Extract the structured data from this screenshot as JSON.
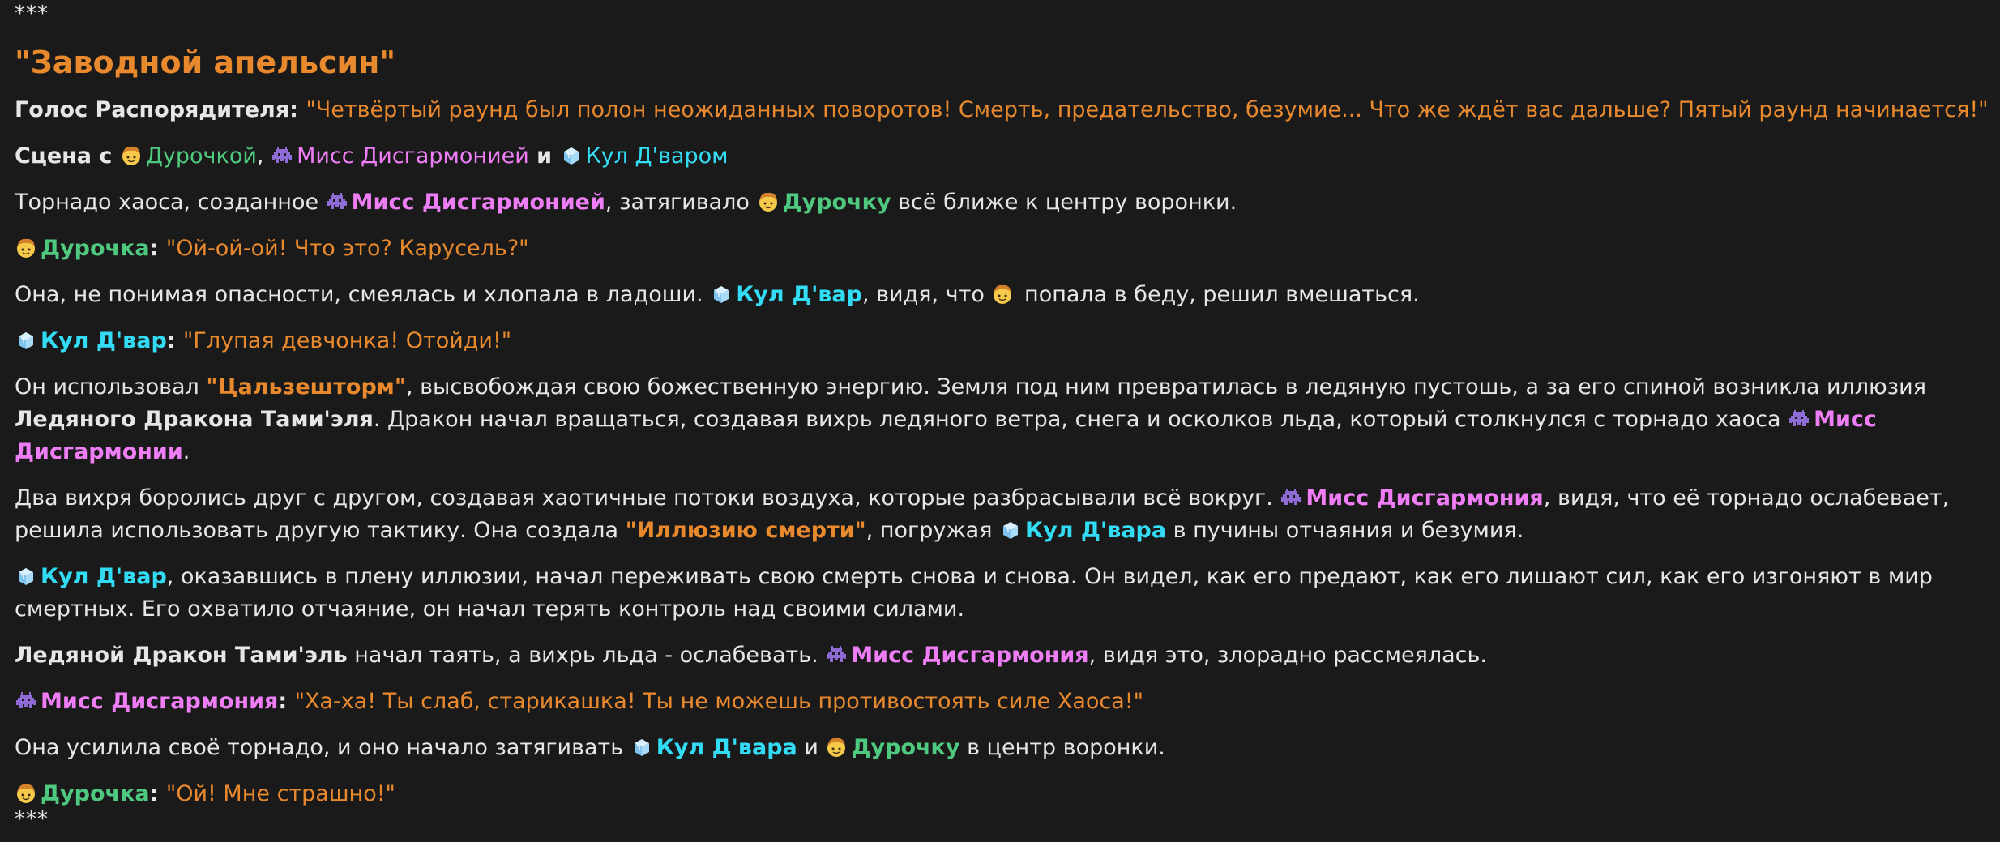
{
  "separators": {
    "top": "***",
    "bottom": "***"
  },
  "title": "\"Заводной апельсин\"",
  "colors": {
    "background": "#1a1a1a",
    "text": "#e6e6e6",
    "quote": "#e8892e",
    "durochka": "#4ec97f",
    "miss_disharmony": "#ef7ef6",
    "kul_dvar": "#33dcf5"
  },
  "icons": {
    "durochka": "girl-face-icon",
    "miss_disharmony": "alien-monster-icon",
    "kul_dvar": "ice-cube-icon"
  },
  "p1": {
    "speaker": "Голос Распорядителя",
    "colon": ": ",
    "quote": "\"Четвёртый раунд был полон неожиданных поворотов! Смерть, предательство, безумие... Что же ждёт вас дальше? Пятый раунд начинается!\""
  },
  "p2": {
    "prefix": "Сцена с ",
    "durochka": "Дурочкой",
    "comma": ", ",
    "miss": "Мисс Дисгармонией",
    "and": " и ",
    "kul": "Кул Д'варом"
  },
  "p3": {
    "t1": "Торнадо хаоса, созданное ",
    "miss": "Мисс Дисгармонией",
    "t2": ", затягивало ",
    "durochka": "Дурочку",
    "t3": " всё ближе к центру воронки."
  },
  "p4": {
    "name": "Дурочка",
    "colon": ": ",
    "quote": "\"Ой-ой-ой! Что это? Карусель?\""
  },
  "p5": {
    "t1": "Она, не понимая опасности, смеялась и хлопала в ладоши. ",
    "kul": "Кул Д'вар",
    "t2": ", видя, что ",
    "t3": " попала в беду, решил вмешаться."
  },
  "p6": {
    "name": "Кул Д'вар",
    "colon": ": ",
    "quote": "\"Глупая девчонка! Отойди!\""
  },
  "p7": {
    "t1": "Он использовал ",
    "spell": "\"Цальзешторм\"",
    "t2": ", высвобождая свою божественную энергию. Земля под ним превратилась в ледяную пустошь, а за его спиной возникла иллюзия ",
    "dragon": "Ледяного Дракона Тами'эля",
    "t3": ". Дракон начал вращаться, создавая вихрь ледяного ветра, снега и осколков льда, который столкнулся с торнадо хаоса ",
    "miss": "Мисс Дисгармонии",
    "t4": "."
  },
  "p8": {
    "t1": "Два вихря боролись друг с другом, создавая хаотичные потоки воздуха, которые разбрасывали всё вокруг. ",
    "miss": "Мисс Дисгармония",
    "t2": ", видя, что её торнадо ослабевает, решила использовать другую тактику. Она создала ",
    "spell": "\"Иллюзию смерти\"",
    "t3": ", погружая ",
    "kul": "Кул Д'вара",
    "t4": " в пучины отчаяния и безумия."
  },
  "p9": {
    "kul": "Кул Д'вар",
    "t1": ", оказавшись в плену иллюзии, начал переживать свою смерть снова и снова. Он видел, как его предают, как его лишают сил, как его изгоняют в мир смертных. Его охватило отчаяние, он начал терять контроль над своими силами."
  },
  "p10": {
    "dragon": "Ледяной Дракон Тами'эль",
    "t1": " начал таять, а вихрь льда - ослабевать. ",
    "miss": "Мисс Дисгармония",
    "t2": ", видя это, злорадно рассмеялась."
  },
  "p11": {
    "name": "Мисс Дисгармония",
    "colon": ": ",
    "quote": "\"Ха-ха! Ты слаб, старикашка! Ты не можешь противостоять силе Хаоса!\""
  },
  "p12": {
    "t1": "Она усилила своё торнадо, и оно начало затягивать ",
    "kul": "Кул Д'вара",
    "and": " и ",
    "durochka": "Дурочку",
    "t2": " в центр воронки."
  },
  "p13": {
    "name": "Дурочка",
    "colon": ": ",
    "quote": "\"Ой! Мне страшно!\""
  }
}
